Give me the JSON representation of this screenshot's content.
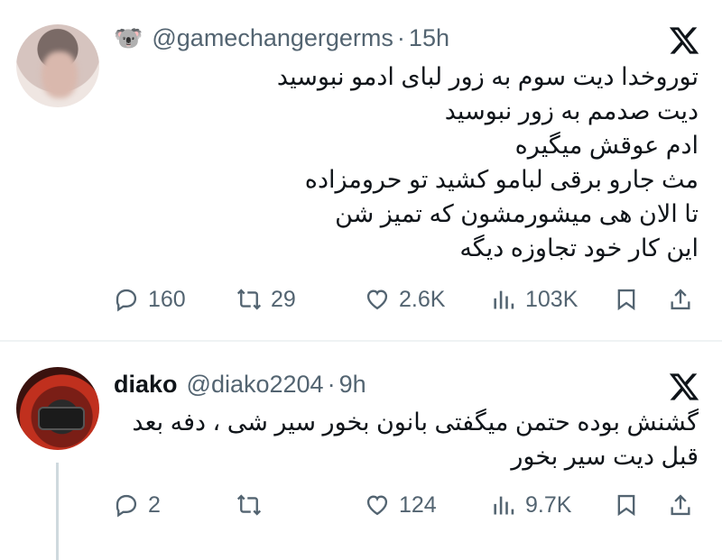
{
  "tweets": [
    {
      "emoji": "🐨",
      "display_name": "",
      "handle": "@gamechangergerms",
      "separator": "·",
      "time": "15h",
      "lines": [
        "توروخدا دیت سوم به زور لبای ادمو نبوسید",
        "دیت صدمم به زور نبوسید",
        "ادم عوقش میگیره",
        "مث جارو برقی لبامو کشید تو حرومزاده",
        "تا الان هی میشورمشون که تمیز شن",
        "این کار خود تجاوزه دیگه"
      ],
      "replies": "160",
      "retweets": "29",
      "likes": "2.6K",
      "views": "103K"
    },
    {
      "emoji": "",
      "display_name": "diako",
      "handle": "@diako2204",
      "separator": "·",
      "time": "9h",
      "lines": [
        "گشنش بوده حتمن میگفتی بانون بخور سیر شی ، دفه بعد",
        "قبل دیت سیر بخور"
      ],
      "replies": "2",
      "retweets": "",
      "likes": "124",
      "views": "9.7K"
    }
  ],
  "icons": {
    "reply": "reply-icon",
    "retweet": "retweet-icon",
    "like": "heart-icon",
    "views": "views-icon",
    "bookmark": "bookmark-icon",
    "share": "share-icon",
    "platform": "x-logo-icon"
  },
  "colors": {
    "text": "#0f1419",
    "secondary": "#536471",
    "divider": "#eff3f4"
  }
}
